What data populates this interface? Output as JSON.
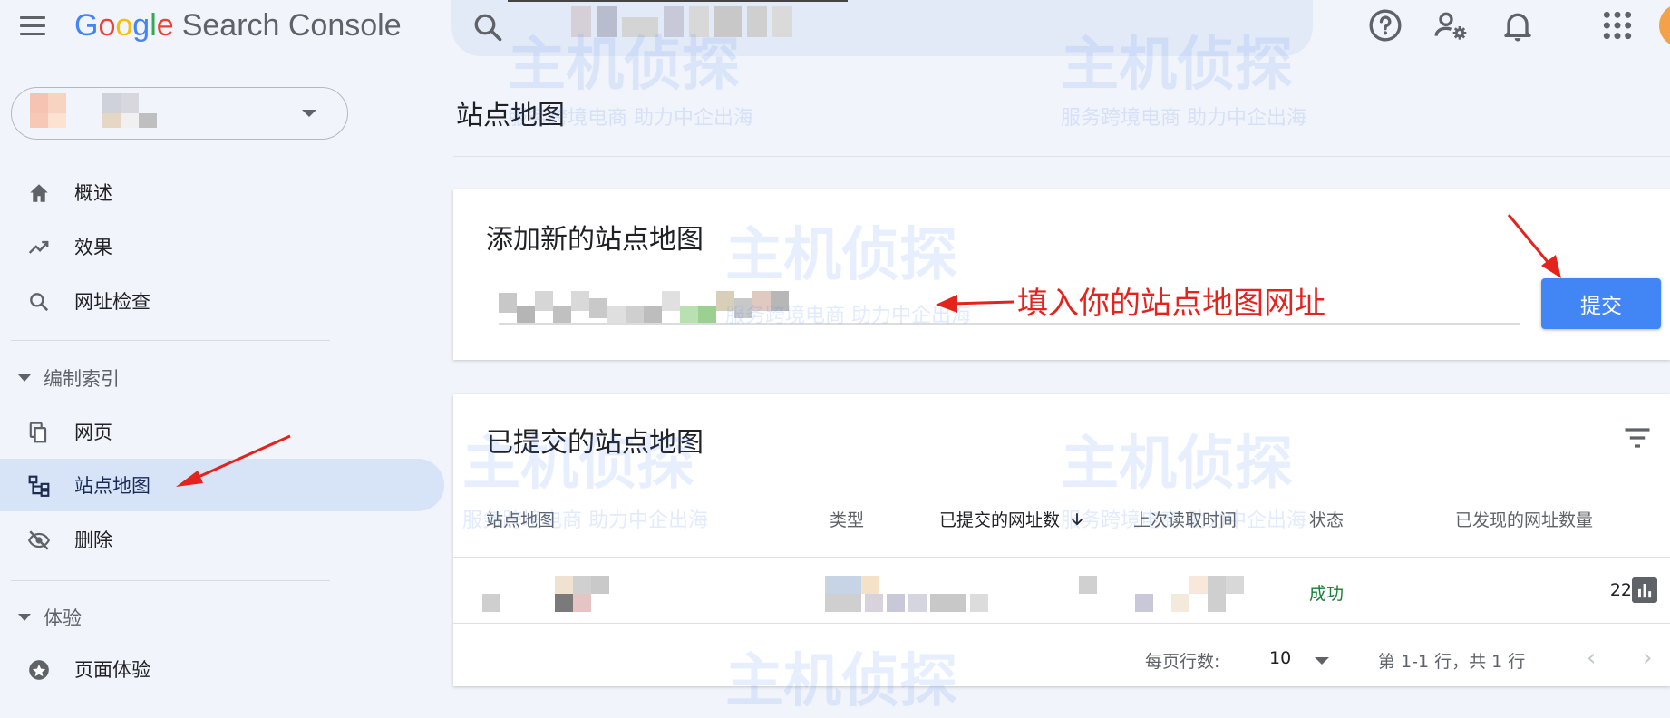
{
  "header": {
    "menu_icon": "hamburger-menu-icon",
    "logo_google": [
      "G",
      "o",
      "o",
      "g",
      "l",
      "e"
    ],
    "logo_colors": [
      "#4285F4",
      "#EA4335",
      "#FBBC05",
      "#4285F4",
      "#34A853",
      "#EA4335"
    ],
    "product_name": "Search Console",
    "icons": [
      "help-icon",
      "manage-users-icon",
      "notifications-icon",
      "apps-grid-icon"
    ]
  },
  "sidebar": {
    "nav_top": [
      {
        "label": "概述",
        "icon": "home-icon"
      },
      {
        "label": "效果",
        "icon": "trending-up-icon"
      },
      {
        "label": "网址检查",
        "icon": "search-icon"
      }
    ],
    "section_index": "编制索引",
    "nav_index": [
      {
        "label": "网页",
        "icon": "pages-icon"
      },
      {
        "label": "站点地图",
        "icon": "sitemap-icon",
        "active": true
      },
      {
        "label": "删除",
        "icon": "visibility-off-icon"
      }
    ],
    "section_experience": "体验",
    "nav_experience": [
      {
        "label": "页面体验",
        "icon": "page-experience-icon"
      }
    ]
  },
  "main": {
    "page_title": "站点地图",
    "add_card": {
      "title": "添加新的站点地图",
      "submit_label": "提交",
      "annotation": "填入你的站点地图网址"
    },
    "submitted_card": {
      "title": "已提交的站点地图",
      "columns": [
        "站点地图",
        "类型",
        "已提交的网址数",
        "上次读取时间",
        "状态",
        "已发现的网址数量"
      ],
      "rows": [
        {
          "status": "成功",
          "discovered": "22"
        }
      ],
      "rows_per_page_label": "每页行数:",
      "rows_per_page_value": "10",
      "range_text": "第 1-1 行，共 1 行"
    }
  },
  "watermark": {
    "brand": "主机侦探",
    "slogan": "服务跨境电商  助力中企出海"
  },
  "colors": {
    "accent": "#4285f4",
    "annotation_red": "#e3231c",
    "active_nav_bg": "#d7e4f8",
    "success": "#188038"
  }
}
